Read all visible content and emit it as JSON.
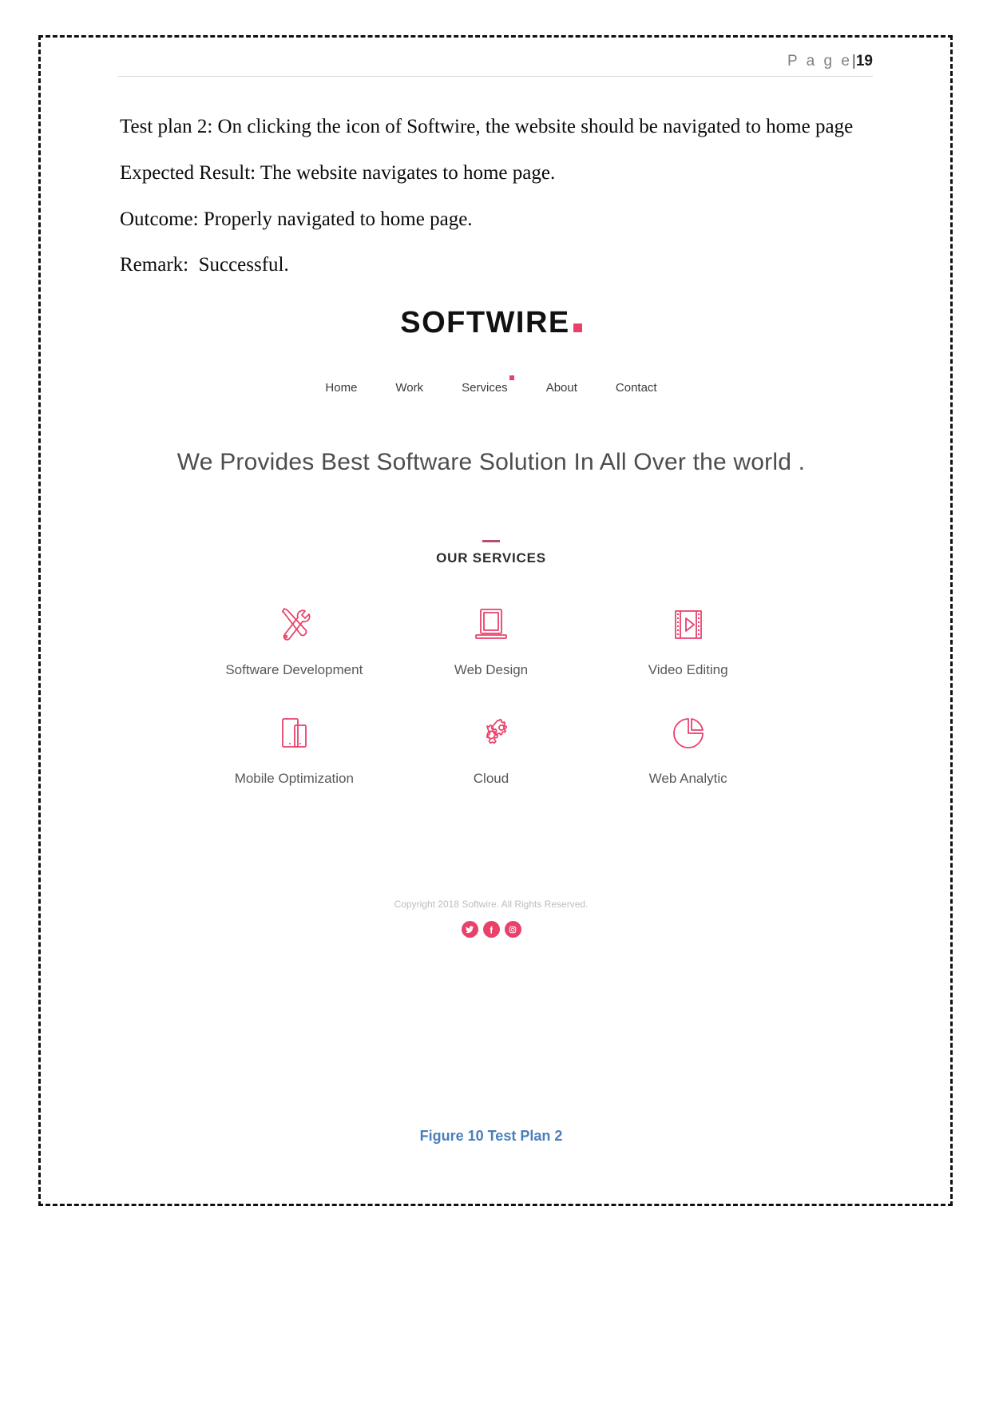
{
  "header": {
    "page_word": "P a g e",
    "separator": "|",
    "page_number": "19"
  },
  "body": {
    "paragraphs": [
      "Test plan 2: On clicking the icon of Softwire, the website should be navigated to home page",
      "Expected Result: The website navigates to home page.",
      "Outcome: Properly navigated to home page.",
      "Remark:  Successful."
    ]
  },
  "figure": {
    "caption": "Figure 10 Test Plan 2",
    "website": {
      "logo_text": "SOFTWIRE",
      "nav": [
        {
          "label": "Home",
          "has_dot": false
        },
        {
          "label": "Work",
          "has_dot": false
        },
        {
          "label": "Services",
          "has_dot": true
        },
        {
          "label": "About",
          "has_dot": false
        },
        {
          "label": "Contact",
          "has_dot": false
        }
      ],
      "hero_tagline": "We Provides Best Software Solution In All Over the world .",
      "services_heading": "OUR SERVICES",
      "services": [
        {
          "label": "Software Development",
          "icon": "tools-icon"
        },
        {
          "label": "Web Design",
          "icon": "laptop-icon"
        },
        {
          "label": "Video Editing",
          "icon": "film-play-icon"
        },
        {
          "label": "Mobile Optimization",
          "icon": "devices-icon"
        },
        {
          "label": "Cloud",
          "icon": "gears-icon"
        },
        {
          "label": "Web Analytic",
          "icon": "pie-chart-icon"
        }
      ],
      "footer_copyright": "Copyright 2018 Softwire. All Rights Reserved.",
      "social": [
        {
          "name": "twitter-icon"
        },
        {
          "name": "facebook-icon"
        },
        {
          "name": "instagram-icon"
        }
      ]
    }
  },
  "colors": {
    "accent_pink": "#e8426b",
    "caption_blue": "#4a7ebb",
    "body_text": "#0b0b0b",
    "header_gray": "#7f7f7f"
  }
}
